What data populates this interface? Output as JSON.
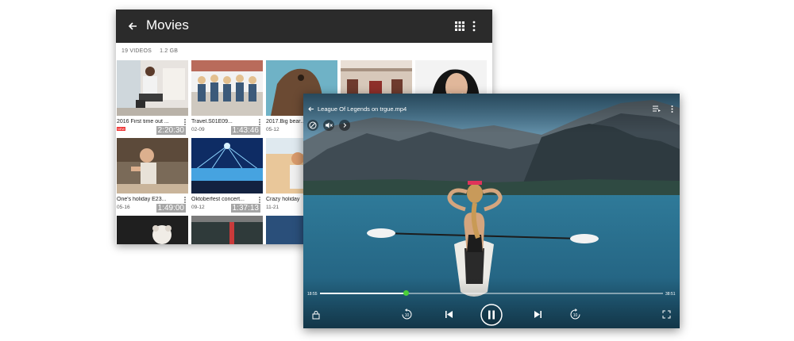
{
  "library": {
    "title": "Movies",
    "video_count": "19 VIDEOS",
    "total_size": "1.2 GB",
    "icons": [
      "back-arrow-icon",
      "grid-view-icon",
      "more-vert-icon"
    ],
    "videos": [
      {
        "title": "2016 First time out ...",
        "date": "",
        "duration": "2:20:30",
        "new": true
      },
      {
        "title": "Travel.S01E09...",
        "date": "02-09",
        "duration": "1:43:46",
        "new": false
      },
      {
        "title": "2017.Big bear...",
        "date": "05-12",
        "duration": "",
        "new": false
      },
      {
        "title": "One's holiday E23...",
        "date": "05-16",
        "duration": "1:49:00",
        "new": false
      },
      {
        "title": "Oktoberfest concert...",
        "date": "09-12",
        "duration": "1:37:13",
        "new": false
      },
      {
        "title": "Crazy holiday",
        "date": "11-21",
        "duration": "",
        "new": false
      }
    ],
    "new_badge": "NEW"
  },
  "player": {
    "title": "League Of Legends on trgue.mp4",
    "elapsed": "18:55",
    "total": "38:51",
    "progress": 0.25,
    "accent": "#4bd138",
    "icons": [
      "back-arrow-icon",
      "playlist-icon",
      "more-vert-icon",
      "rotation-lock-icon",
      "mute-icon",
      "chevron-right-icon",
      "lock-icon",
      "rewind-10-icon",
      "skip-previous-icon",
      "pause-icon",
      "skip-next-icon",
      "forward-10-icon",
      "fullscreen-icon"
    ]
  }
}
